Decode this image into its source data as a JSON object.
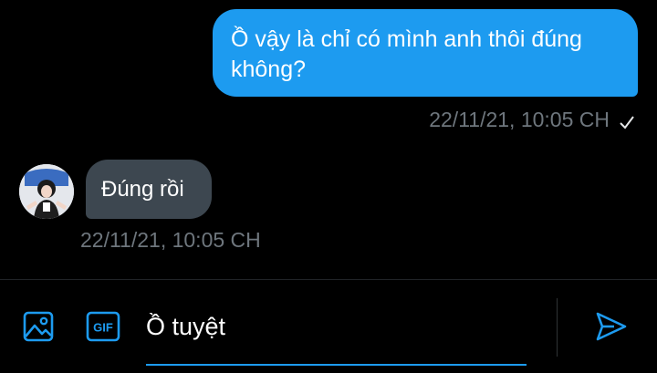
{
  "messages": {
    "outgoing": {
      "text": "Ồ vậy là chỉ có mình anh thôi đúng không?",
      "timestamp": "22/11/21, 10:05 CH",
      "status_icon": "check-icon"
    },
    "incoming": {
      "text": "Đúng rồi",
      "timestamp": "22/11/21, 10:05 CH",
      "avatar_icon": "avatar"
    }
  },
  "composer": {
    "input_value": "Ồ tuyệt",
    "gif_label": "GIF",
    "icons": [
      "image-icon",
      "gif-icon",
      "send-icon"
    ]
  },
  "colors": {
    "background": "#000000",
    "accent": "#1d9bf0",
    "incoming_bubble": "#3d4750",
    "muted_text": "#6e767d"
  }
}
